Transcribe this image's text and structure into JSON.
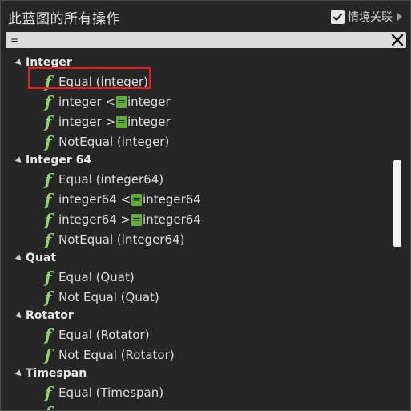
{
  "header": {
    "title": "此蓝图的所有操作",
    "context_sensitive": {
      "label": "情境关联",
      "checked": true
    }
  },
  "search": {
    "value": "="
  },
  "tree": [
    {
      "label": "Integer",
      "items": [
        {
          "label": "Equal (integer)",
          "selected": true
        },
        {
          "parts": [
            "integer <",
            "=",
            " integer"
          ]
        },
        {
          "parts": [
            "integer >",
            "=",
            " integer"
          ]
        },
        {
          "label": "NotEqual (integer)"
        }
      ]
    },
    {
      "label": "Integer 64",
      "items": [
        {
          "label": "Equal (integer64)"
        },
        {
          "parts": [
            "integer64 <",
            "=",
            " integer64"
          ]
        },
        {
          "parts": [
            "integer64 >",
            "=",
            " integer64"
          ]
        },
        {
          "label": "NotEqual (integer64)"
        }
      ]
    },
    {
      "label": "Quat",
      "items": [
        {
          "label": "Equal (Quat)"
        },
        {
          "label": "Not Equal (Quat)"
        }
      ]
    },
    {
      "label": "Rotator",
      "items": [
        {
          "label": "Equal (Rotator)"
        },
        {
          "label": "Not Equal (Rotator)"
        }
      ]
    },
    {
      "label": "Timespan",
      "items": [
        {
          "label": "Equal (Timespan)"
        }
      ]
    }
  ],
  "colors": {
    "function_icon": "#8fd46d",
    "match_highlight": "#63ad3a",
    "selection_outline": "#e02020"
  },
  "icons": {
    "function": "function-icon",
    "close": "close-icon",
    "checkbox": "checkbox-icon",
    "expand_arrow": "expand-arrow-icon"
  }
}
